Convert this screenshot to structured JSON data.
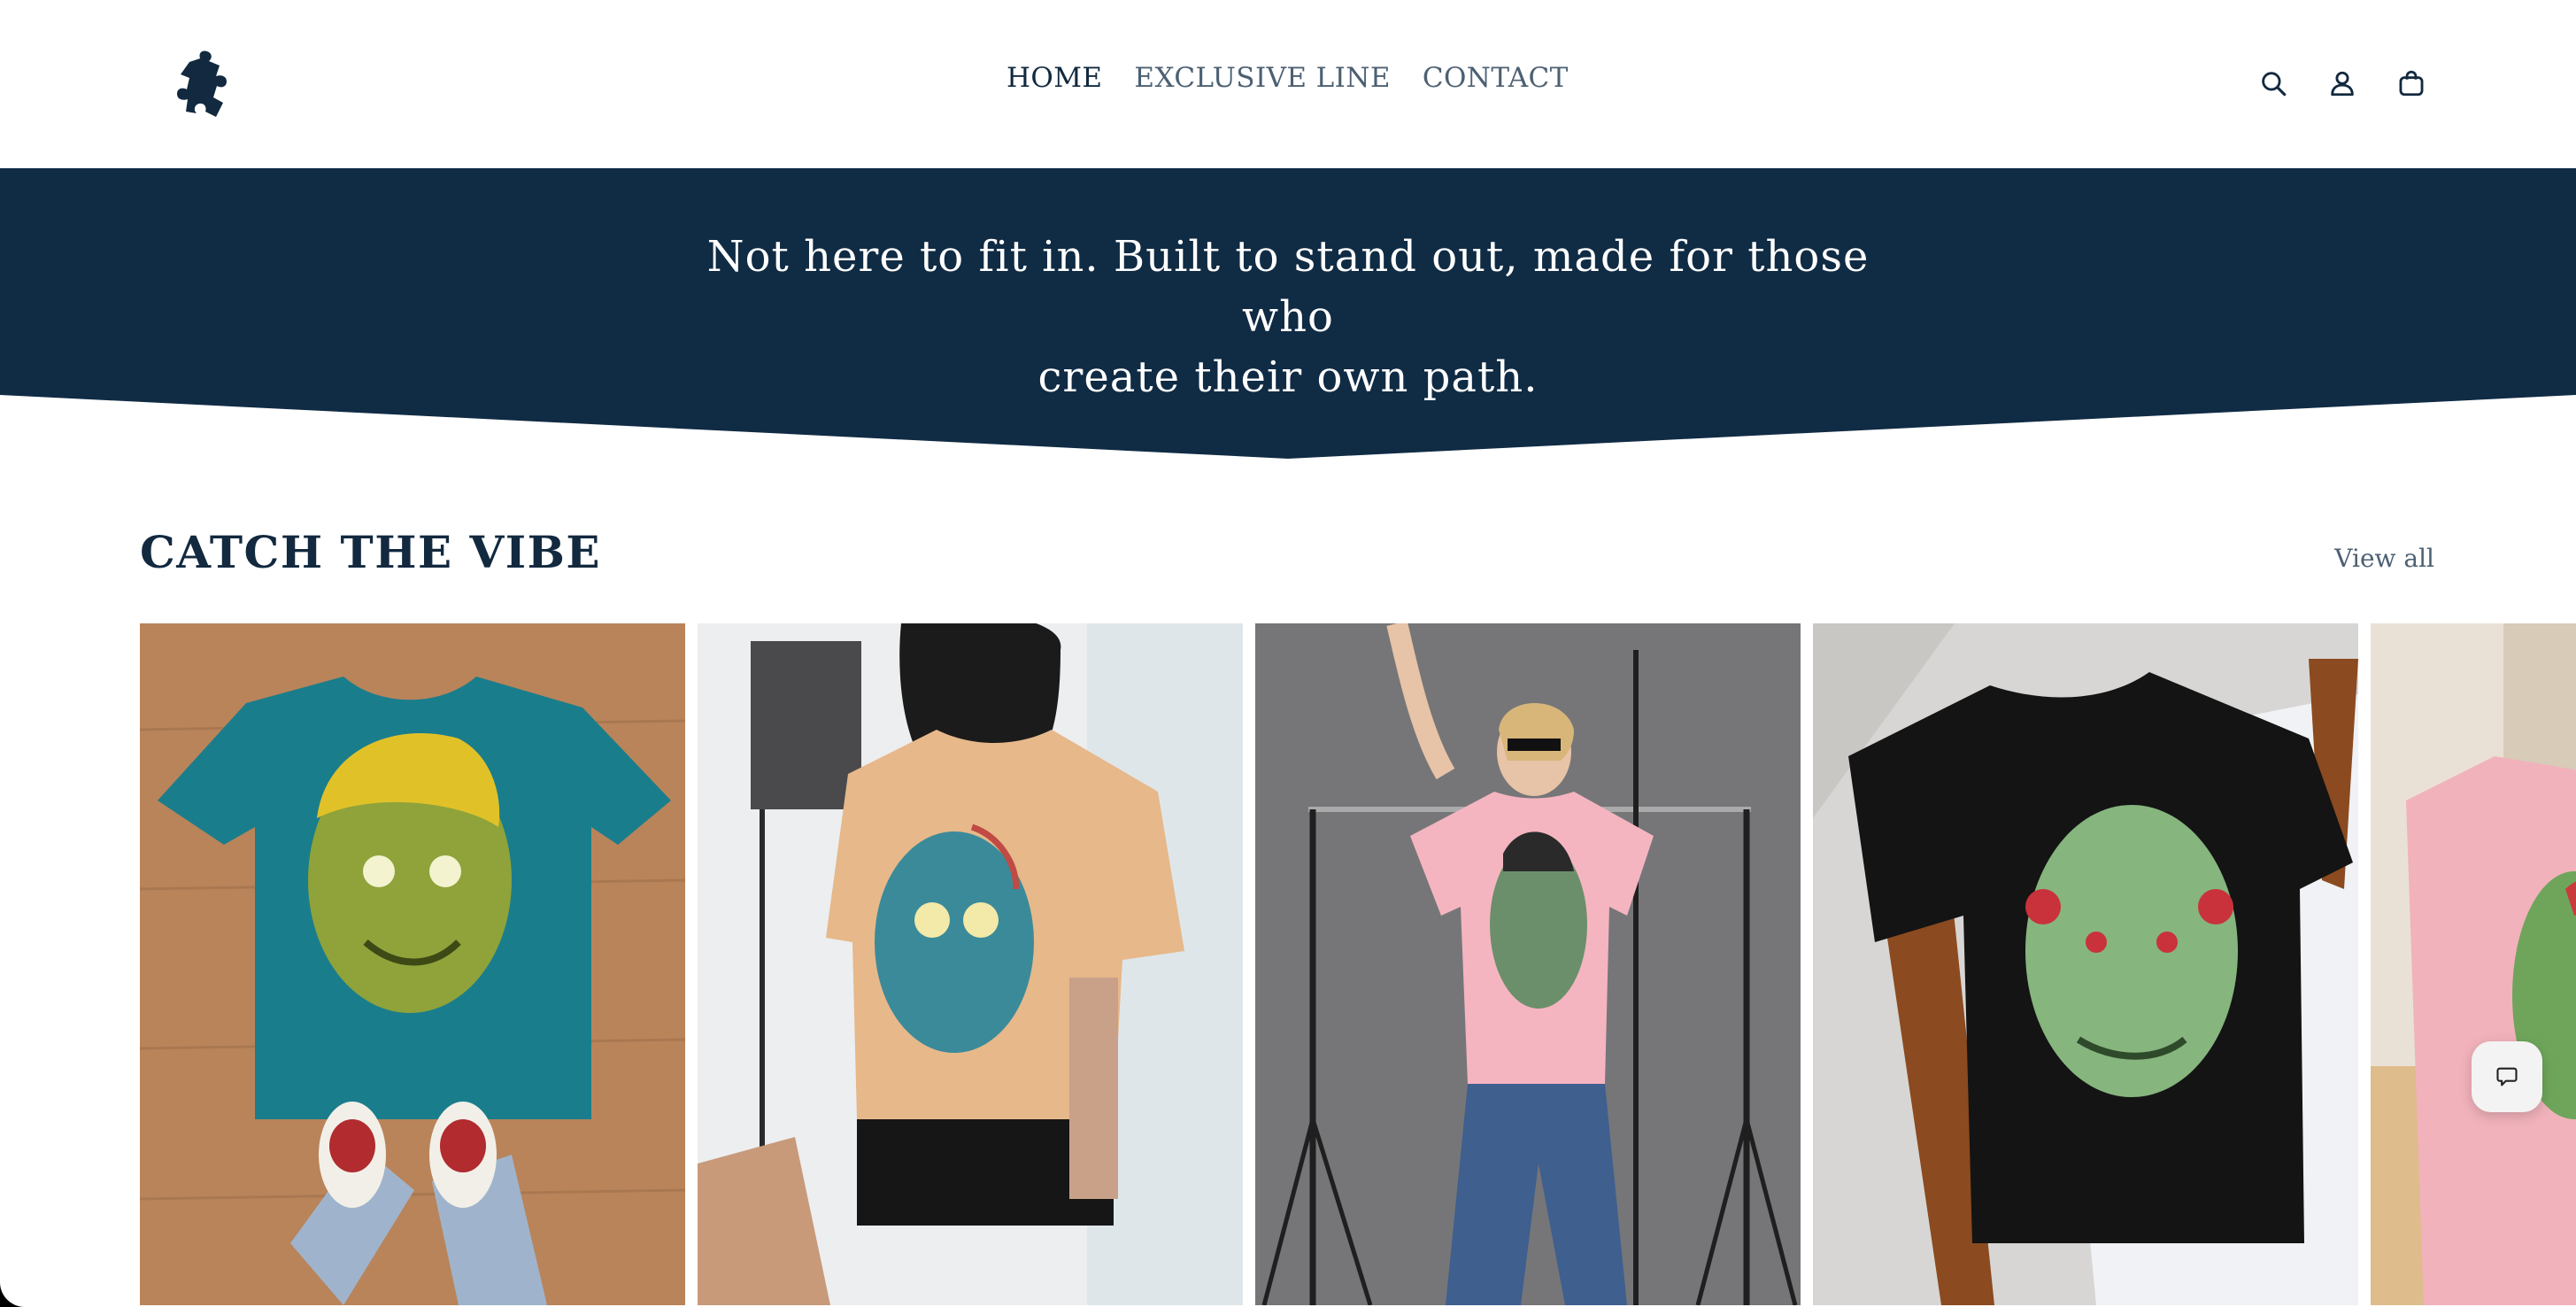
{
  "brand": {
    "logo_icon": "puzzle-piece-icon",
    "color": "#12293f"
  },
  "nav": {
    "items": [
      {
        "label": "HOME",
        "active": true
      },
      {
        "label": "EXCLUSIVE LINE",
        "active": false
      },
      {
        "label": "CONTACT",
        "active": false
      }
    ]
  },
  "header_icons": [
    "search-icon",
    "account-icon",
    "cart-icon"
  ],
  "banner": {
    "line1": "Not here to fit in. Built to stand out, made for those who",
    "line2": "create their own path.",
    "background": "#102b44"
  },
  "collection": {
    "title": "CATCH THE VIBE",
    "view_all": "View all",
    "products": [
      {
        "image": "teal t-shirt with green zombie head graphic on wooden floor"
      },
      {
        "image": "person wearing tan t-shirt with blue skull graphic"
      },
      {
        "image": "woman in pink t-shirt with zombie graphic in studio"
      },
      {
        "image": "black t-shirt with green zombie graphic on chair"
      },
      {
        "image": "pink t-shirt with green zombie graphic"
      }
    ]
  },
  "chat": {
    "icon": "chat-bubble-icon"
  }
}
